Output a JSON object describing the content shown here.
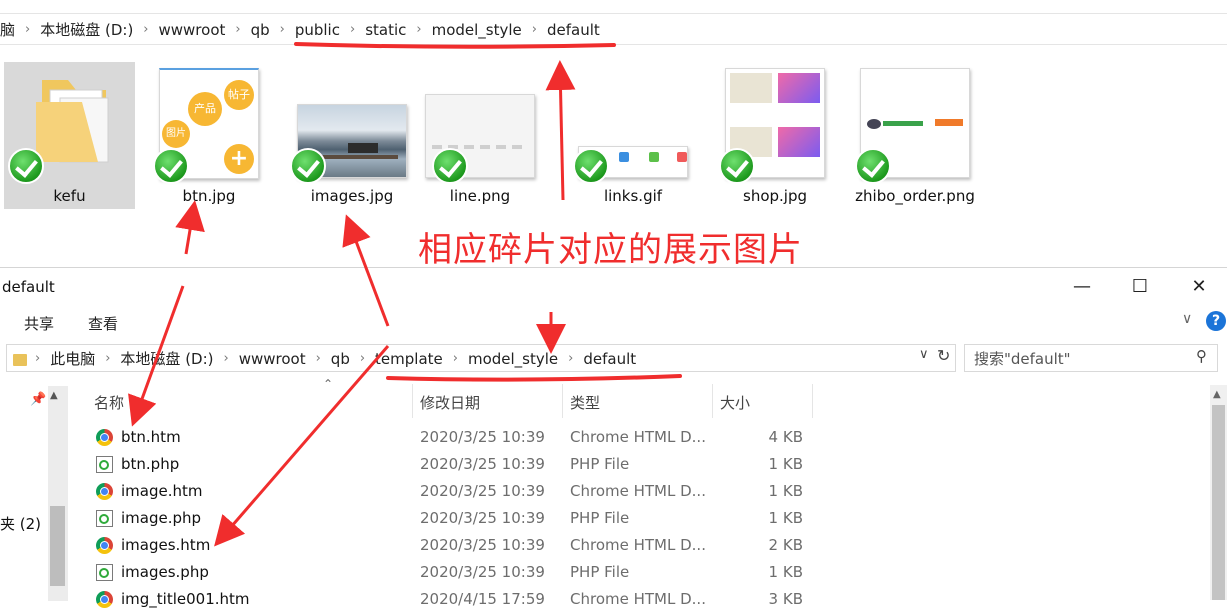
{
  "top_window": {
    "breadcrumb": [
      "脑",
      "本地磁盘 (D:)",
      "wwwroot",
      "qb",
      "public",
      "static",
      "model_style",
      "default"
    ],
    "items": [
      {
        "label": "kefu",
        "kind": "folder",
        "icon": "folder-icon"
      },
      {
        "label": "btn.jpg",
        "kind": "image",
        "icon": "btn-thumbnail-icon",
        "badges": [
          "帖子",
          "产品",
          "图片",
          "+"
        ]
      },
      {
        "label": "images.jpg",
        "kind": "image",
        "icon": "landscape-thumbnail-icon"
      },
      {
        "label": "line.png",
        "kind": "image",
        "icon": "line-thumbnail-icon"
      },
      {
        "label": "links.gif",
        "kind": "image",
        "icon": "links-thumbnail-icon"
      },
      {
        "label": "shop.jpg",
        "kind": "image",
        "icon": "shop-thumbnail-icon"
      },
      {
        "label": "zhibo_order.png",
        "kind": "image",
        "icon": "order-thumbnail-icon"
      }
    ],
    "check_icon": "green-check-icon"
  },
  "annotation": {
    "text": "相应碎片对应的展示图片",
    "color": "#f02d2d"
  },
  "bottom_window": {
    "title": "default",
    "ribbon_tabs": [
      "共享",
      "查看"
    ],
    "address": [
      "此电脑",
      "本地磁盘 (D:)",
      "wwwroot",
      "qb",
      "template",
      "model_style",
      "default"
    ],
    "search_placeholder": "搜索\"default\"",
    "columns": {
      "name": "名称",
      "date": "修改日期",
      "type": "类型",
      "size": "大小"
    },
    "nav_item": "夹 (2)",
    "files": [
      {
        "name": "btn.htm",
        "date": "2020/3/25 10:39",
        "type": "Chrome HTML D...",
        "size": "4 KB",
        "icon": "chrome-icon"
      },
      {
        "name": "btn.php",
        "date": "2020/3/25 10:39",
        "type": "PHP File",
        "size": "1 KB",
        "icon": "php-file-icon"
      },
      {
        "name": "image.htm",
        "date": "2020/3/25 10:39",
        "type": "Chrome HTML D...",
        "size": "1 KB",
        "icon": "chrome-icon"
      },
      {
        "name": "image.php",
        "date": "2020/3/25 10:39",
        "type": "PHP File",
        "size": "1 KB",
        "icon": "php-file-icon"
      },
      {
        "name": "images.htm",
        "date": "2020/3/25 10:39",
        "type": "Chrome HTML D...",
        "size": "2 KB",
        "icon": "chrome-icon"
      },
      {
        "name": "images.php",
        "date": "2020/3/25 10:39",
        "type": "PHP File",
        "size": "1 KB",
        "icon": "php-file-icon"
      },
      {
        "name": "img_title001.htm",
        "date": "2020/4/15 17:59",
        "type": "Chrome HTML D...",
        "size": "3 KB",
        "icon": "chrome-icon"
      }
    ]
  },
  "colors": {
    "annotation_red": "#f02d2d",
    "check_green": "#1e9a1e",
    "help_blue": "#1b74d8",
    "folder_yellow": "#e9c25a"
  }
}
